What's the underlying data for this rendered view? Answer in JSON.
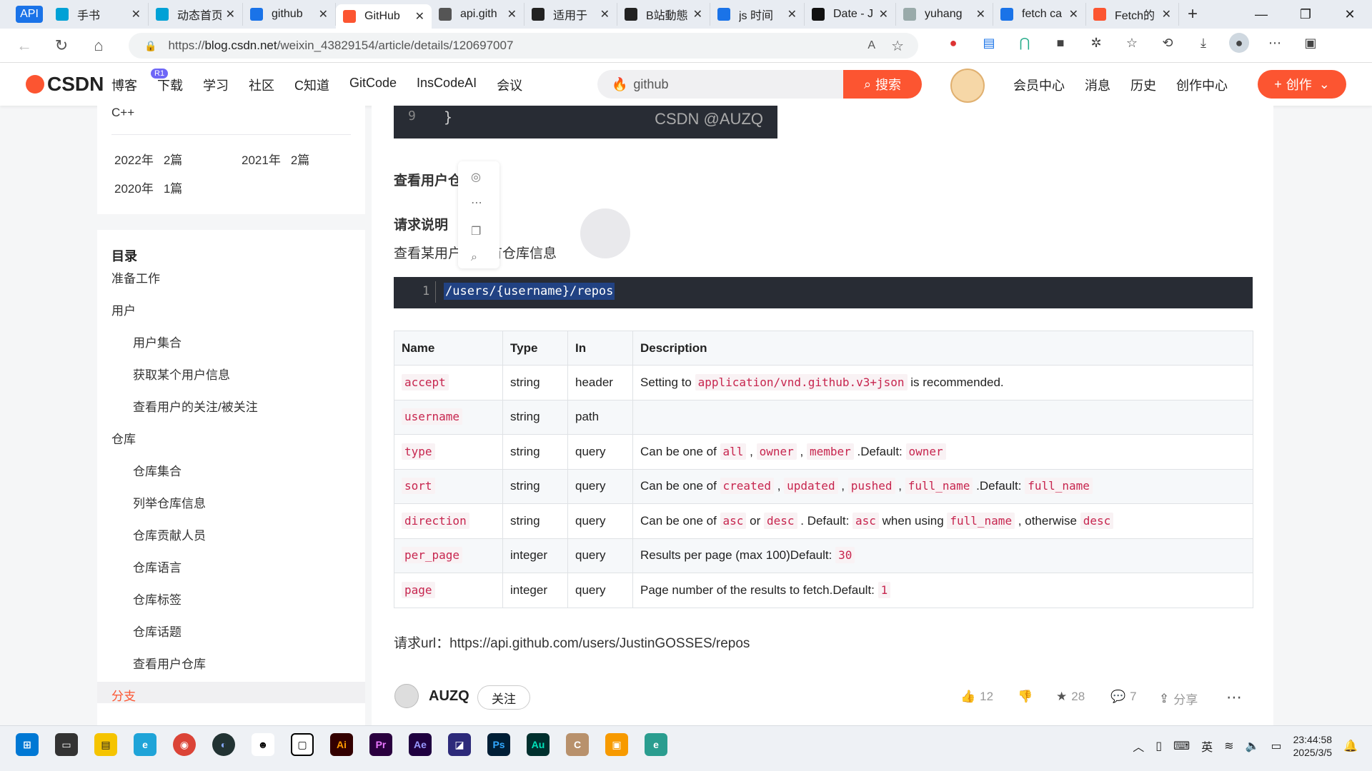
{
  "browser": {
    "api_pill": "API",
    "tabs": [
      {
        "label": "手书",
        "icon": "bilibili-icon",
        "color": "#00a1d6"
      },
      {
        "label": "动态首页",
        "icon": "bilibili-icon",
        "color": "#00a1d6"
      },
      {
        "label": "github",
        "icon": "search-icon",
        "color": "#1a73e8"
      },
      {
        "label": "GitHub",
        "icon": "csdn-icon",
        "color": "#fc5531",
        "active": true
      },
      {
        "label": "api.gith",
        "icon": "document-icon",
        "color": "#555555"
      },
      {
        "label": "适用于",
        "icon": "github-icon",
        "color": "#222222"
      },
      {
        "label": "B站動態",
        "icon": "bilibili-tv-icon",
        "color": "#222222"
      },
      {
        "label": "js 时间",
        "icon": "search-icon",
        "color": "#1a73e8"
      },
      {
        "label": "Date - J",
        "icon": "mdn-icon",
        "color": "#111111"
      },
      {
        "label": "yuhang",
        "icon": "image-icon",
        "color": "#9aa"
      },
      {
        "label": "fetch ca",
        "icon": "search-icon",
        "color": "#1a73e8"
      },
      {
        "label": "Fetch的",
        "icon": "csdn-icon",
        "color": "#fc5531"
      }
    ],
    "new_tab": "+",
    "url_prefix": "https://",
    "url_domain": "blog.csdn.net",
    "url_path": "/weixin_43829154/article/details/120697007"
  },
  "csdn": {
    "logo": "CSDN",
    "nav": [
      "博客",
      "下载",
      "学习",
      "社区",
      "C知道",
      "GitCode",
      "InsCodeAI",
      "会议"
    ],
    "r1_badge": "R1",
    "search_value": "github",
    "search_button": "搜索",
    "right_nav": [
      "会员中心",
      "消息",
      "历史",
      "创作中心"
    ],
    "create_button": "创作"
  },
  "sidebar": {
    "cpp": "C++",
    "archive": [
      {
        "year": "2022年",
        "count": "2篇"
      },
      {
        "year": "2021年",
        "count": "2篇"
      },
      {
        "year": "2020年",
        "count": "1篇"
      }
    ],
    "toc_title": "目录",
    "toc": [
      {
        "label": "准备工作",
        "level": 1
      },
      {
        "label": "用户",
        "level": 1
      },
      {
        "label": "用户集合",
        "level": 2
      },
      {
        "label": "获取某个用户信息",
        "level": 2
      },
      {
        "label": "查看用户的关注/被关注",
        "level": 2
      },
      {
        "label": "仓库",
        "level": 1
      },
      {
        "label": "仓库集合",
        "level": 2
      },
      {
        "label": "列举仓库信息",
        "level": 2
      },
      {
        "label": "仓库贡献人员",
        "level": 2
      },
      {
        "label": "仓库语言",
        "level": 2
      },
      {
        "label": "仓库标签",
        "level": 2
      },
      {
        "label": "仓库话题",
        "level": 2
      },
      {
        "label": "查看用户仓库",
        "level": 2
      },
      {
        "label": "分支",
        "level": 1,
        "active": true
      }
    ]
  },
  "article": {
    "code_top_line": "9",
    "code_top_text": "}",
    "watermark": "CSDN @AUZQ",
    "section_title": "查看用户仓库",
    "req_title": "请求说明",
    "req_desc": "查看某用户的所有仓库信息",
    "code_line": "1",
    "code_text": "/users/{username}/repos",
    "table_headers": [
      "Name",
      "Type",
      "In",
      "Description"
    ],
    "request_url_label": "请求url：",
    "request_url": "https://api.github.com/users/JustinGOSSES/repos"
  },
  "footer": {
    "author": "AUZQ",
    "follow": "关注",
    "likes": "12",
    "stars": "28",
    "comments": "7",
    "share": "分享"
  },
  "taskbar": {
    "ime": "英",
    "time": "23:44:58",
    "date": "2025/3/5"
  }
}
